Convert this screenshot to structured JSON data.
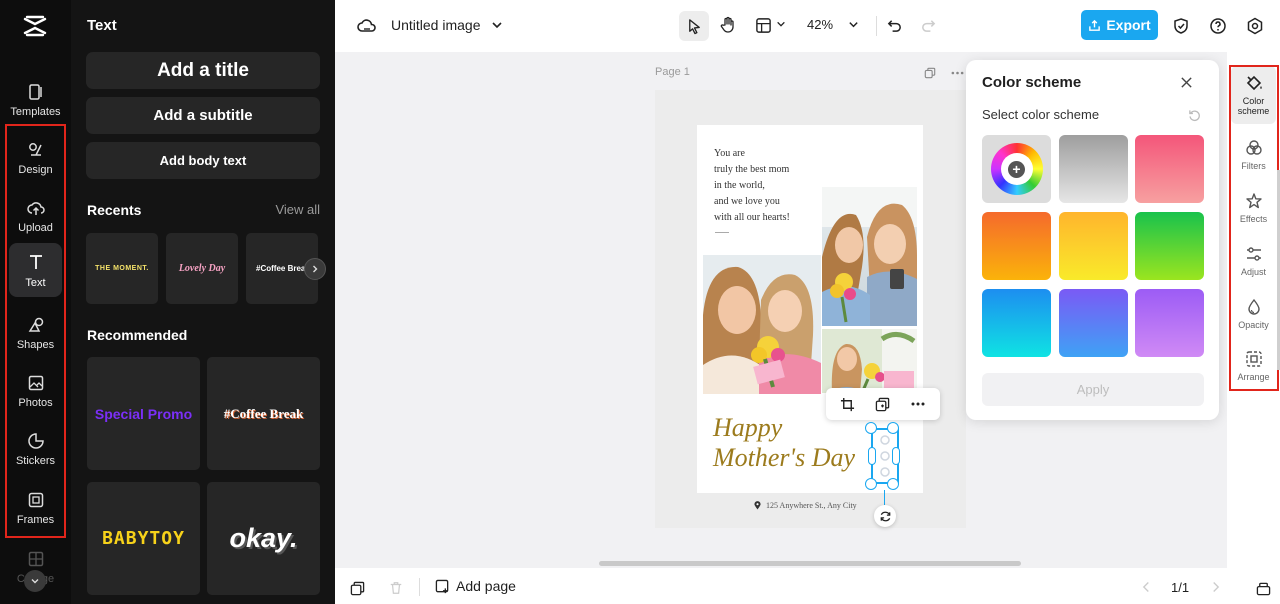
{
  "rail": {
    "items": [
      {
        "label": "Templates"
      },
      {
        "label": "Design"
      },
      {
        "label": "Upload"
      },
      {
        "label": "Text"
      },
      {
        "label": "Shapes"
      },
      {
        "label": "Photos"
      },
      {
        "label": "Stickers"
      },
      {
        "label": "Frames"
      },
      {
        "label": "Collage"
      }
    ]
  },
  "panel": {
    "title": "Text",
    "add_title": "Add a title",
    "add_subtitle": "Add a subtitle",
    "add_body": "Add body text",
    "recents_title": "Recents",
    "view_all": "View all",
    "recents": [
      "THE MOMENT.",
      "Lovely Day",
      "#Coffee Break"
    ],
    "recommended_title": "Recommended",
    "recommended": [
      "Special Promo",
      "#Coffee Break",
      "BABYTOY",
      "okay."
    ]
  },
  "topbar": {
    "doc_title": "Untitled image",
    "zoom": "42%",
    "export": "Export"
  },
  "canvas": {
    "page_label": "Page 1",
    "message_lines": [
      "You are",
      "truly the best mom",
      "in the world,",
      "and we love you",
      "with all our hearts!"
    ],
    "happy_line1": "Happy",
    "happy_line2": "Mother's Day",
    "address": "125 Anywhere St., Any City"
  },
  "color_scheme": {
    "title": "Color scheme",
    "subtitle": "Select color scheme",
    "apply": "Apply",
    "swatches": [
      {
        "name": "custom-wheel"
      },
      {
        "name": "gray",
        "from": "#9e9e9e",
        "to": "#e6e6e6"
      },
      {
        "name": "pink",
        "from": "#f4567a",
        "to": "#f7a0a0"
      },
      {
        "name": "orange",
        "from": "#f56a2c",
        "to": "#fbb30a"
      },
      {
        "name": "yellow",
        "from": "#ffb52d",
        "to": "#f9ea2a"
      },
      {
        "name": "green",
        "from": "#19c24c",
        "to": "#9be51f"
      },
      {
        "name": "cyan",
        "from": "#1d8ef0",
        "to": "#0fe3e3"
      },
      {
        "name": "blue",
        "from": "#7a5af5",
        "to": "#3fa2f5"
      },
      {
        "name": "purple",
        "from": "#9c5cf5",
        "to": "#d08af5"
      }
    ]
  },
  "right_rail": {
    "items": [
      {
        "label": "Color scheme"
      },
      {
        "label": "Filters"
      },
      {
        "label": "Effects"
      },
      {
        "label": "Adjust"
      },
      {
        "label": "Opacity"
      },
      {
        "label": "Arrange"
      }
    ]
  },
  "bottombar": {
    "add_page": "Add page",
    "page_count": "1/1"
  },
  "colors": {
    "accent": "#1aa7f0",
    "highlight": "#e1251b",
    "gold_text": "#9c7b1d"
  }
}
